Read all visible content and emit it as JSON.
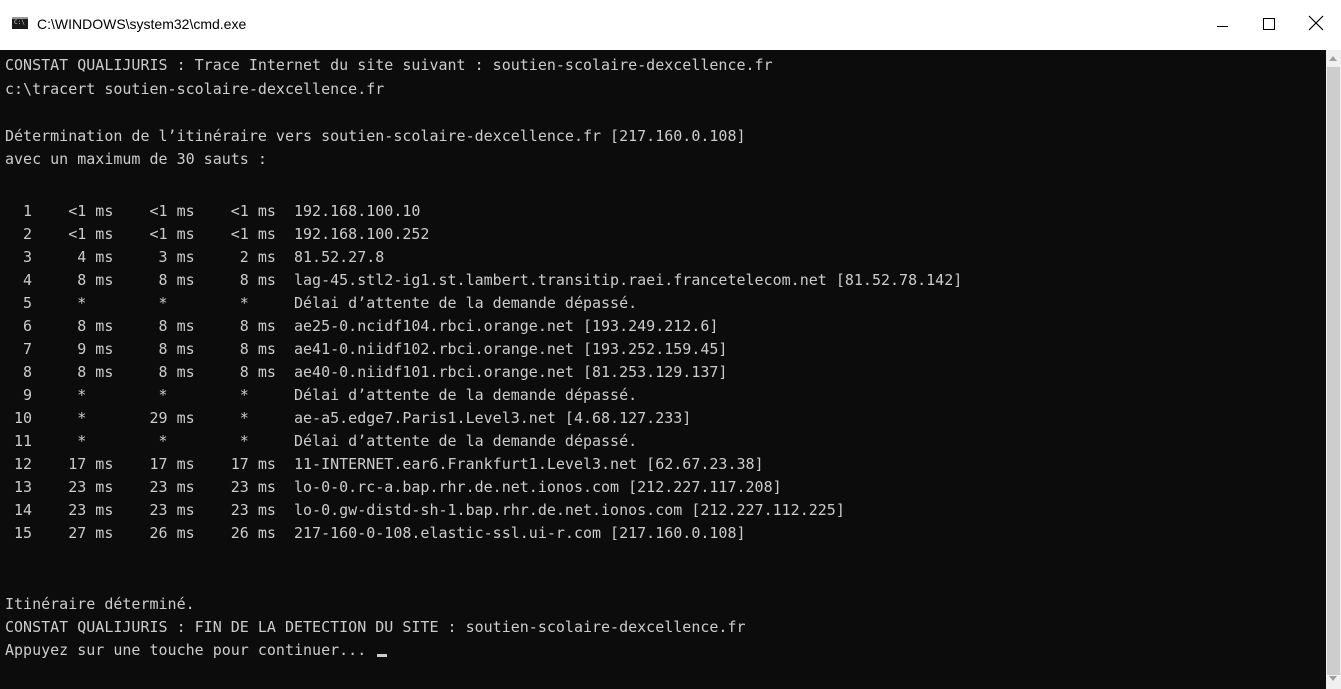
{
  "window": {
    "title": "C:\\WINDOWS\\system32\\cmd.exe",
    "icon": "cmd-icon"
  },
  "console": {
    "lines": [
      "CONSTAT QUALIJURIS : Trace Internet du site suivant : soutien-scolaire-dexcellence.fr",
      "c:\\tracert soutien-scolaire-dexcellence.fr",
      "",
      "Détermination de l’itinéraire vers soutien-scolaire-dexcellence.fr [217.160.0.108]",
      "avec un maximum de 30 sauts :",
      "",
      "  1    <1 ms    <1 ms    <1 ms  192.168.100.10",
      "  2    <1 ms    <1 ms    <1 ms  192.168.100.252",
      "  3     4 ms     3 ms     2 ms  81.52.27.8",
      "  4     8 ms     8 ms     8 ms  lag-45.stl2-ig1.st.lambert.transitip.raei.francetelecom.net [81.52.78.142]",
      "  5     *        *        *     Délai d’attente de la demande dépassé.",
      "  6     8 ms     8 ms     8 ms  ae25-0.ncidf104.rbci.orange.net [193.249.212.6]",
      "  7     9 ms     8 ms     8 ms  ae41-0.niidf102.rbci.orange.net [193.252.159.45]",
      "  8     8 ms     8 ms     8 ms  ae40-0.niidf101.rbci.orange.net [81.253.129.137]",
      "  9     *        *        *     Délai d’attente de la demande dépassé.",
      " 10     *       29 ms     *     ae-a5.edge7.Paris1.Level3.net [4.68.127.233]",
      " 11     *        *        *     Délai d’attente de la demande dépassé.",
      " 12    17 ms    17 ms    17 ms  11-INTERNET.ear6.Frankfurt1.Level3.net [62.67.23.38]",
      " 13    23 ms    23 ms    23 ms  lo-0-0.rc-a.bap.rhr.de.net.ionos.com [212.227.117.208]",
      " 14    23 ms    23 ms    23 ms  lo-0.gw-distd-sh-1.bap.rhr.de.net.ionos.com [212.227.112.225]",
      " 15    27 ms    26 ms    26 ms  217-160-0-108.elastic-ssl.ui-r.com [217.160.0.108]",
      "",
      "Itinéraire déterminé.",
      "CONSTAT QUALIJURIS : FIN DE LA DETECTION DU SITE : soutien-scolaire-dexcellence.fr",
      "Appuyez sur une touche pour continuer... "
    ]
  },
  "colors": {
    "console_background": "#0c0c0c",
    "console_text": "#cccccc",
    "titlebar_background": "#ffffff"
  }
}
